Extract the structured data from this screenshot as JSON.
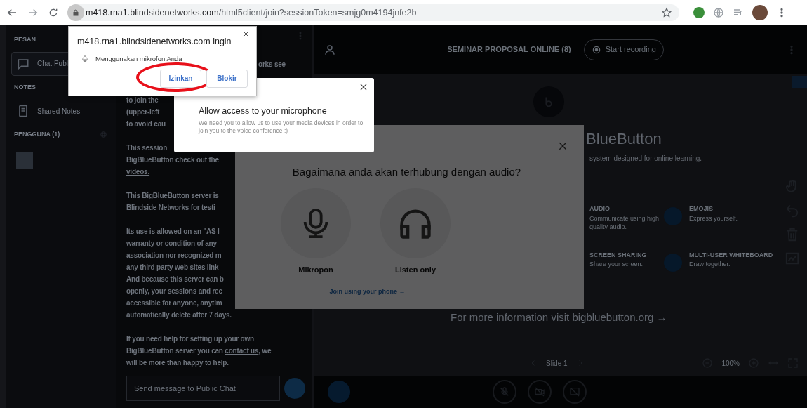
{
  "browser": {
    "url_host": "m418.rna1.blindsidenetworks.com",
    "url_path": "/html5client/join?sessionToken=smjg0m4194jnfe2b"
  },
  "sidebar": {
    "sections": [
      {
        "title": "PESAN",
        "items": [
          {
            "kind": "chat",
            "label": "Chat Publ",
            "selected": true
          }
        ]
      },
      {
        "title": "NOTES",
        "items": [
          {
            "kind": "notes",
            "label": "Shared Notes",
            "selected": false
          }
        ]
      },
      {
        "title": "PENGGUNA (1)",
        "items": [
          {
            "kind": "user",
            "selected": false
          }
        ]
      }
    ]
  },
  "chat": {
    "paragraphs": [
      [
        {
          "text": "orks see"
        },
        {
          "text": "to join the"
        },
        {
          "text": "(upper-left"
        },
        {
          "text": "to avoid cau"
        }
      ],
      [
        {
          "text": "This session"
        },
        {
          "text": "BigBlueButton check out the"
        },
        {
          "link": "videos."
        }
      ],
      [
        {
          "text": "This BigBlueButton server is"
        },
        {
          "link": "Blindside Networks",
          "after": " for testi"
        }
      ],
      [
        {
          "text": "Its use is allowed on an \"AS I"
        },
        {
          "text": "warranty or condition of any"
        },
        {
          "text": "association nor recognized m"
        },
        {
          "text": "any third party web sites link"
        },
        {
          "text": "And because this server can b"
        },
        {
          "text": "openly, your sessions and rec"
        },
        {
          "text": "accessible for anyone, anytim"
        },
        {
          "text": "automatically delete after 7 days."
        }
      ],
      [
        {
          "text": "If you need help for setting up your own"
        },
        {
          "text": "BigBlueButton server you can ",
          "link": "contact us",
          "after": ", we"
        },
        {
          "text": "will be more than happy to help."
        }
      ]
    ],
    "input": {
      "placeholder": "Send message to Public Chat"
    }
  },
  "main": {
    "title": "SEMINAR PROPOSAL ONLINE (8)",
    "record_button": "Start recording",
    "presentation": {
      "heading": "BlueButton",
      "subtitle": "system designed for online learning.",
      "features": [
        {
          "title": "AUDIO",
          "desc": "Communicate using high quality audio."
        },
        {
          "title": "EMOJIS",
          "desc": "Express yourself."
        },
        {
          "title": "SCREEN SHARING",
          "desc": "Share your screen."
        },
        {
          "title": "MULTI-USER WHITEBOARD",
          "desc": "Draw together."
        }
      ],
      "more_info": {
        "text": "For more information visit ",
        "link": "bigbluebutton.org →"
      }
    },
    "slide_controls": {
      "slide": "Slide 1",
      "zoom": "100%"
    }
  },
  "audio_modal": {
    "title": "Bagaimana anda akan terhubung dengan audio?",
    "options": [
      {
        "kind": "mic",
        "label": "Mikropon"
      },
      {
        "kind": "headphones",
        "label": "Listen only"
      }
    ],
    "phone_link": "Join using your phone →"
  },
  "mic_prompt": {
    "title": "Allow access to your microphone",
    "text": "We need you to allow us to use your media devices in order to join you to the voice conference :)"
  },
  "permission_popup": {
    "origin_text": "m418.rna1.blindsidenetworks.com ingin",
    "permission": "Menggunakan mikrofon Anda",
    "buttons": [
      {
        "label": "Izinkan",
        "highlighted": true
      },
      {
        "label": "Blokir",
        "highlighted": false
      }
    ]
  }
}
